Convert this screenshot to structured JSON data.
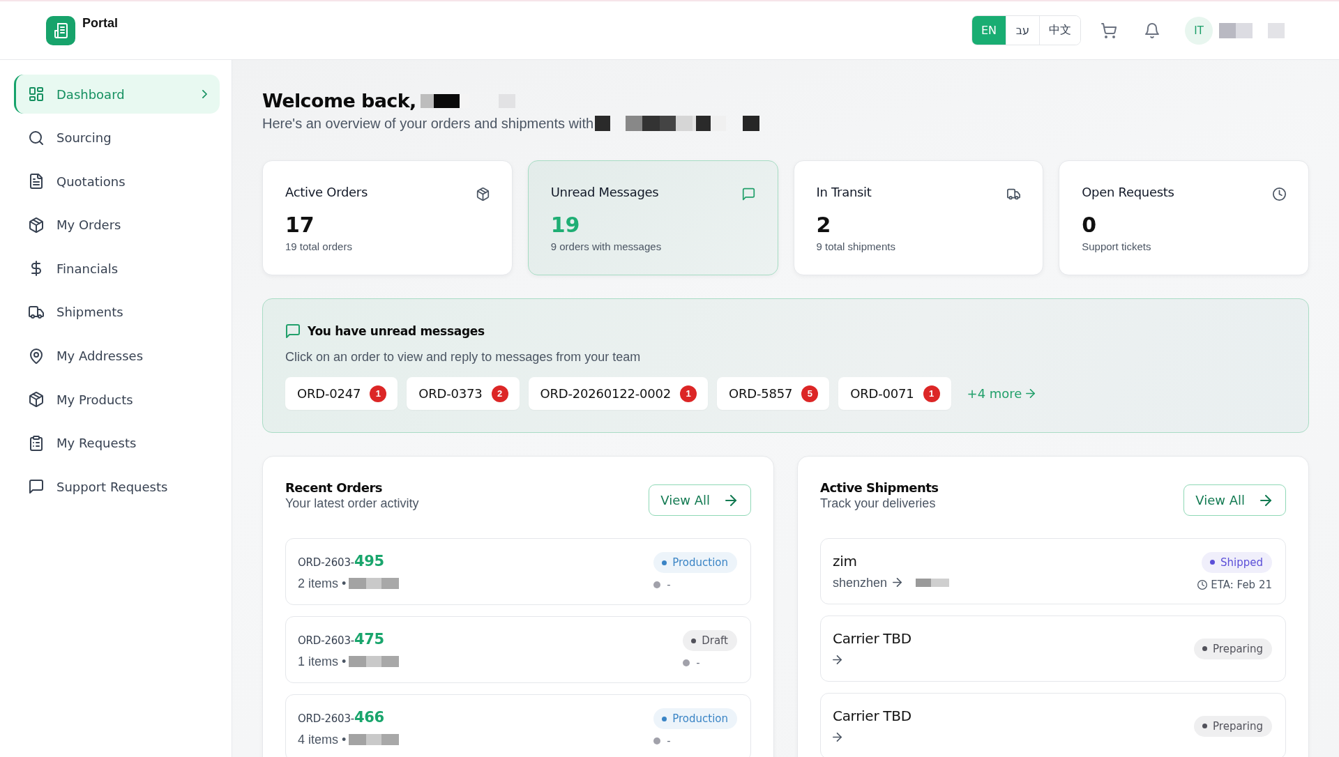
{
  "header": {
    "app_name": "Portal",
    "languages": [
      {
        "label": "EN",
        "selected": true
      },
      {
        "label": "עב",
        "selected": false
      },
      {
        "label": "中文",
        "selected": false
      }
    ],
    "avatar_initials": "IT"
  },
  "sidebar": {
    "items": [
      {
        "label": "Dashboard",
        "selected": true
      },
      {
        "label": "Sourcing",
        "selected": false
      },
      {
        "label": "Quotations",
        "selected": false
      },
      {
        "label": "My Orders",
        "selected": false
      },
      {
        "label": "Financials",
        "selected": false
      },
      {
        "label": "Shipments",
        "selected": false
      },
      {
        "label": "My Addresses",
        "selected": false
      },
      {
        "label": "My Products",
        "selected": false
      },
      {
        "label": "My Requests",
        "selected": false
      },
      {
        "label": "Support Requests",
        "selected": false
      }
    ]
  },
  "welcome": {
    "title": "Welcome back,",
    "subtitle": "Here's an overview of your orders and shipments with"
  },
  "stats": [
    {
      "label": "Active Orders",
      "value": "17",
      "caption": "19 total orders",
      "highlighted": false
    },
    {
      "label": "Unread Messages",
      "value": "19",
      "caption": "9 orders with messages",
      "highlighted": true
    },
    {
      "label": "In Transit",
      "value": "2",
      "caption": "9 total shipments",
      "highlighted": false
    },
    {
      "label": "Open Requests",
      "value": "0",
      "caption": "Support tickets",
      "highlighted": false
    }
  ],
  "unread_messages": {
    "title": "You have unread messages",
    "description": "Click on an order to view and reply to messages from your team",
    "orders": [
      {
        "order": "ORD-0247",
        "count": "1"
      },
      {
        "order": "ORD-0373",
        "count": "2"
      },
      {
        "order": "ORD-20260122-0002",
        "count": "1"
      },
      {
        "order": "ORD-5857",
        "count": "5"
      },
      {
        "order": "ORD-0071",
        "count": "1"
      }
    ],
    "more_link": "+4 more"
  },
  "recent_orders": {
    "title": "Recent Orders",
    "subtitle": "Your latest order activity",
    "view_all": "View All",
    "orders": [
      {
        "number": "ORD-2603-**495**",
        "items": "2 items •",
        "status": {
          "label": "Production",
          "color": "#3a84c5"
        },
        "payment": {
          "label": "-",
          "color": "#a1a1aa"
        }
      },
      {
        "number": "ORD-2603-**475**",
        "items": "1 items •",
        "status": {
          "label": "Draft",
          "color": "#52525b"
        },
        "payment": {
          "label": "-",
          "color": "#a1a1aa"
        }
      },
      {
        "number": "ORD-2603-**466**",
        "items": "4 items •",
        "status": {
          "label": "Production",
          "color": "#3a84c5"
        },
        "payment": {
          "label": "-",
          "color": "#a1a1aa"
        }
      }
    ]
  },
  "active_shipments": {
    "title": "Active Shipments",
    "subtitle": "Track your deliveries",
    "view_all": "View All",
    "shipments": [
      {
        "carrier": "zim",
        "origin": "shenzhen",
        "status": {
          "label": "Shipped",
          "color": "#5b4fd8"
        },
        "eta": "ETA: Feb 21"
      },
      {
        "carrier": "Carrier TBD",
        "status": {
          "label": "Preparing",
          "color": "#52525b"
        }
      },
      {
        "carrier": "Carrier TBD",
        "status": {
          "label": "Preparing",
          "color": "#52525b"
        }
      }
    ]
  }
}
